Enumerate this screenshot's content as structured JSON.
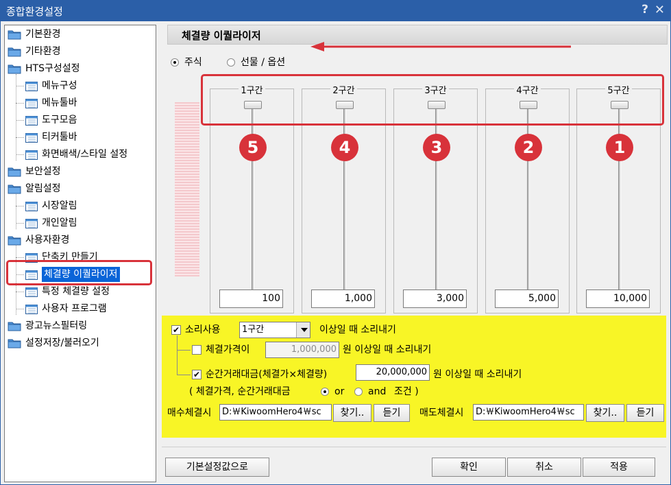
{
  "window": {
    "title": "종합환경설정",
    "help_icon": "?",
    "close_icon": "✕"
  },
  "tree": {
    "items": [
      {
        "label": "기본환경",
        "type": "folder"
      },
      {
        "label": "기타환경",
        "type": "folder"
      },
      {
        "label": "HTS구성설정",
        "type": "folder"
      },
      {
        "label": "메뉴구성",
        "type": "doc"
      },
      {
        "label": "메뉴툴바",
        "type": "doc"
      },
      {
        "label": "도구모음",
        "type": "doc"
      },
      {
        "label": "티커툴바",
        "type": "doc"
      },
      {
        "label": "화면배색/스타일 설정",
        "type": "doc"
      },
      {
        "label": "보안설정",
        "type": "folder"
      },
      {
        "label": "알림설정",
        "type": "folder"
      },
      {
        "label": "시장알림",
        "type": "doc"
      },
      {
        "label": "개인알림",
        "type": "doc"
      },
      {
        "label": "사용자환경",
        "type": "folder"
      },
      {
        "label": "단축키 만들기",
        "type": "doc"
      },
      {
        "label": "체결량 이퀄라이저",
        "type": "doc",
        "selected": true
      },
      {
        "label": "특정 체결량 설정",
        "type": "doc"
      },
      {
        "label": "사용자 프로그램",
        "type": "doc"
      },
      {
        "label": "광고뉴스필터링",
        "type": "folder"
      },
      {
        "label": "설정저장/불러오기",
        "type": "folder"
      }
    ]
  },
  "panel": {
    "title": "체결량 이퀄라이저",
    "radio_stock": "주식",
    "radio_futures": "선물 / 옵션",
    "zones": [
      {
        "label": "1구간",
        "badge": "5",
        "value": "100"
      },
      {
        "label": "2구간",
        "badge": "4",
        "value": "1,000"
      },
      {
        "label": "3구간",
        "badge": "3",
        "value": "3,000"
      },
      {
        "label": "4구간",
        "badge": "2",
        "value": "5,000"
      },
      {
        "label": "5구간",
        "badge": "1",
        "value": "10,000"
      }
    ]
  },
  "sound": {
    "use_label": "소리사용",
    "zone_select": "1구간",
    "zone_suffix": "이상일 때 소리내기",
    "price_label": "체결가격이",
    "price_value": "1,000,000",
    "price_suffix": "원 이상일 때 소리내기",
    "amount_label": "순간거래대금(체결가×체결량)",
    "amount_value": "20,000,000",
    "amount_suffix": "원 이상일 때 소리내기",
    "cond_prefix": "( 체결가격, 순간거래대금",
    "cond_or": "or",
    "cond_and": "and",
    "cond_suffix": "조건 )",
    "buy_label": "매수체결시",
    "buy_path": "D:￦KiwoomHero4￦sc",
    "sell_label": "매도체결시",
    "sell_path": "D:￦KiwoomHero4￦sc",
    "find_btn": "찾기..",
    "listen_btn": "듣기"
  },
  "footer": {
    "default_btn": "기본설정값으로",
    "ok_btn": "확인",
    "cancel_btn": "취소",
    "apply_btn": "적용"
  },
  "colors": {
    "titlebar": "#2b5fa8",
    "highlight": "#f8f526",
    "annotation": "#d8323a",
    "selection": "#0a64d8"
  }
}
